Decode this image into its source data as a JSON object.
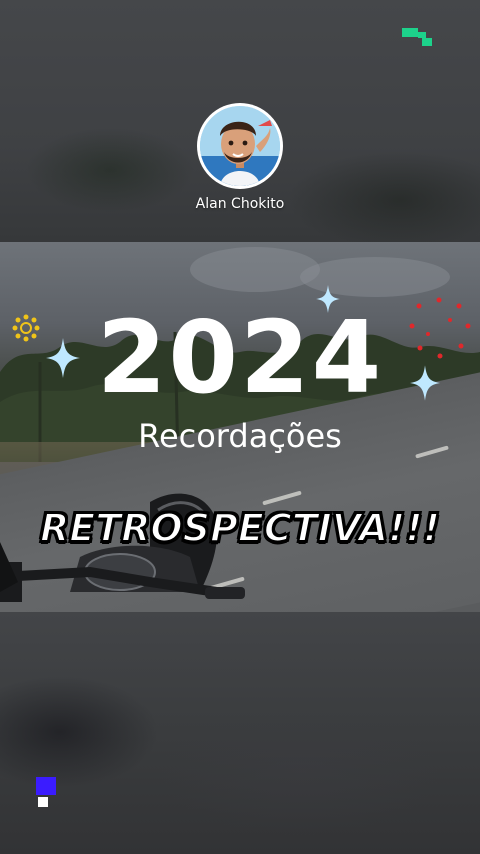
{
  "profile": {
    "username": "Alan Chokito"
  },
  "overlay": {
    "year": "2024",
    "subtitle": "Recordações",
    "caption": "RETROSPECTIVA!!!"
  },
  "icons": {
    "app_logo_top": "tiktok-watermark-icon",
    "app_logo_bottom": "watermark-icon",
    "sparkles": [
      "sparkle-icon",
      "sparkle-icon",
      "sparkle-icon"
    ],
    "flower": "flower-icon",
    "firework": "firework-icon"
  },
  "colors": {
    "logo_green": "#1dd28b",
    "logo_blue": "#3b1cff",
    "sparkle": "#bfe8ff",
    "firework_red": "#e0282b",
    "flower_yellow": "#f0c419"
  }
}
